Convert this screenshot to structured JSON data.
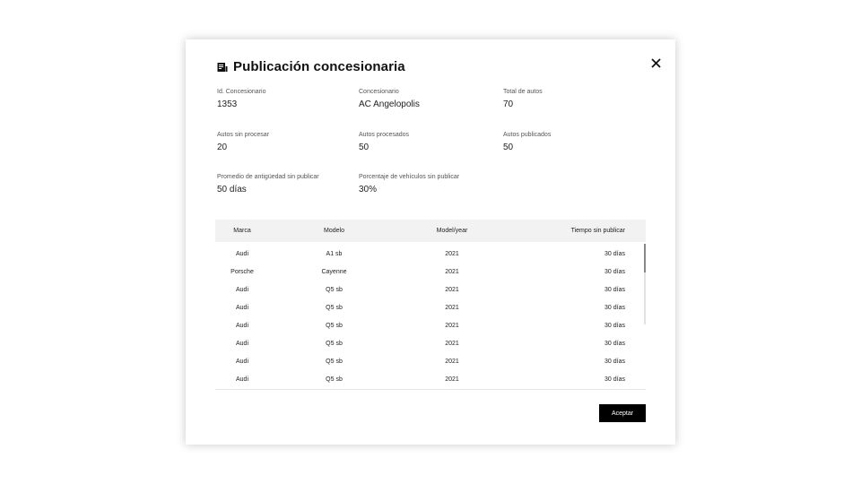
{
  "modal": {
    "title": "Publicación concesionaria",
    "close_icon": "close-icon",
    "title_icon": "document-icon"
  },
  "info": [
    {
      "label": "Id. Concesionario",
      "value": "1353"
    },
    {
      "label": "Concesionario",
      "value": "AC Angelopolis"
    },
    {
      "label": "Total de autos",
      "value": "70"
    },
    {
      "label": "Autos sin procesar",
      "value": "20"
    },
    {
      "label": "Autos procesados",
      "value": "50"
    },
    {
      "label": "Autos publicados",
      "value": "50"
    },
    {
      "label": "Promedio de antigüedad sin publicar",
      "value": "50 días"
    },
    {
      "label": "Porcentaje de vehículos sin publicar",
      "value": "30%"
    }
  ],
  "table": {
    "headers": [
      "Marca",
      "Modelo",
      "Model/year",
      "Tiempo sin publicar"
    ],
    "rows": [
      [
        "Audi",
        "A1 sb",
        "2021",
        "30 días"
      ],
      [
        "Porsche",
        "Cayenne",
        "2021",
        "30 días"
      ],
      [
        "Audi",
        "Q5 sb",
        "2021",
        "30 días"
      ],
      [
        "Audi",
        "Q5 sb",
        "2021",
        "30 días"
      ],
      [
        "Audi",
        "Q5 sb",
        "2021",
        "30 días"
      ],
      [
        "Audi",
        "Q5 sb",
        "2021",
        "30 días"
      ],
      [
        "Audi",
        "Q5 sb",
        "2021",
        "30 días"
      ],
      [
        "Audi",
        "Q5 sb",
        "2021",
        "30 días"
      ]
    ]
  },
  "footer": {
    "accept_label": "Aceptar"
  },
  "colors": {
    "button_bg": "#000000",
    "header_bg": "#f2f2f3"
  }
}
